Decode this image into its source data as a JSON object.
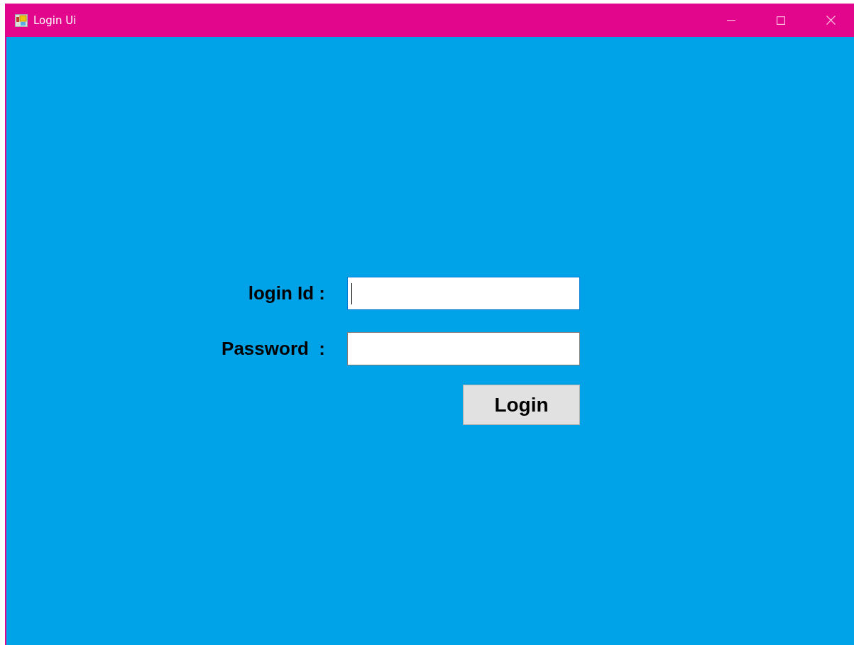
{
  "window": {
    "title": "Login Ui"
  },
  "fields": [
    {
      "label": "login Id :",
      "focused": true
    },
    {
      "label": "Password  :",
      "focused": false
    }
  ],
  "button": {
    "label": "Login"
  }
}
